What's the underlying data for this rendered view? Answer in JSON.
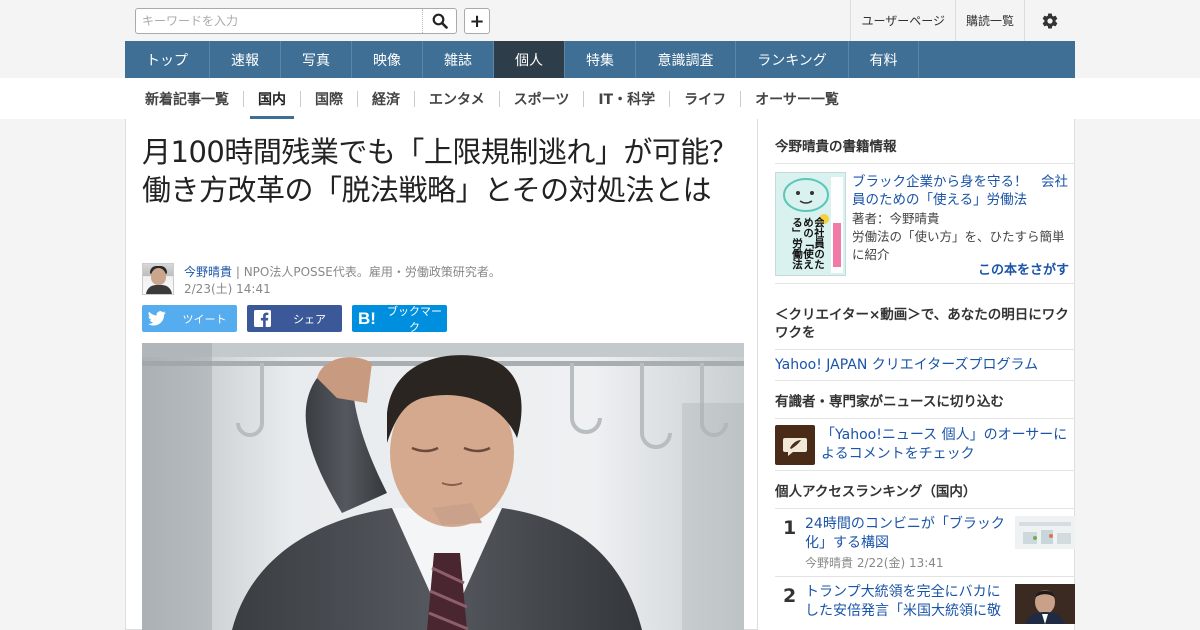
{
  "search": {
    "placeholder": "キーワードを入力"
  },
  "top_links": [
    "ユーザーページ",
    "購読一覧"
  ],
  "main_nav": [
    {
      "label": "トップ",
      "w": 85
    },
    {
      "label": "速報",
      "w": 71
    },
    {
      "label": "写真",
      "w": 71
    },
    {
      "label": "映像",
      "w": 71
    },
    {
      "label": "雑誌",
      "w": 71
    },
    {
      "label": "個人",
      "w": 71,
      "active": true
    },
    {
      "label": "特集",
      "w": 71
    },
    {
      "label": "意識調査",
      "w": 100
    },
    {
      "label": "ランキング",
      "w": 113
    },
    {
      "label": "有料",
      "w": 70
    }
  ],
  "sub_nav": [
    "新着記事一覧",
    "国内",
    "国際",
    "経済",
    "エンタメ",
    "スポーツ",
    "IT・科学",
    "ライフ",
    "オーサー一覧"
  ],
  "sub_nav_active": "国内",
  "article": {
    "title": "月100時間残業でも「上限規制逃れ」が可能？　働き方改革の「脱法戦略」とその対処法とは",
    "author": "今野晴貴",
    "author_desc": "| NPO法人POSSE代表。雇用・労働政策研究者。",
    "date": "2/23(土) 14:41"
  },
  "share": {
    "twitter": "ツイート",
    "facebook": "シェア",
    "hatena": "ブックマーク"
  },
  "sidebar": {
    "book_section_title": "今野晴貴の書籍情報",
    "book_title": "ブラック企業から身を守る！　会社員のための「使える」労働法",
    "book_author": "著者：今野晴貴",
    "book_desc": "労働法の「使い方」を、ひたすら簡単に紹介",
    "book_find": "この本をさがす",
    "book_cover_text": "会社員のための「使える」労働法",
    "creator_title": "＜クリエイター×動画＞で、あなたの明日にワクワクを",
    "creator_link": "Yahoo! JAPAN クリエイターズプログラム",
    "expert_title": "有識者・専門家がニュースに切り込む",
    "expert_link": "「Yahoo!ニュース 個人」のオーサーによるコメントをチェック",
    "ranking_title": "個人アクセスランキング（国内）",
    "ranking": [
      {
        "num": "1",
        "title": "24時間のコンビニが「ブラック化」する構図",
        "meta": "今野晴貴  2/22(金) 13:41"
      },
      {
        "num": "2",
        "title": "トランプ大統領を完全にバカにした安倍発言「米国大統領に敬",
        "meta": ""
      }
    ]
  },
  "colors": {
    "nav_bg": "#3f6f95",
    "nav_active": "#2d3d4a",
    "link": "#1a54a8",
    "twitter": "#55acee",
    "facebook": "#3b5998",
    "hatena": "#008fde"
  }
}
